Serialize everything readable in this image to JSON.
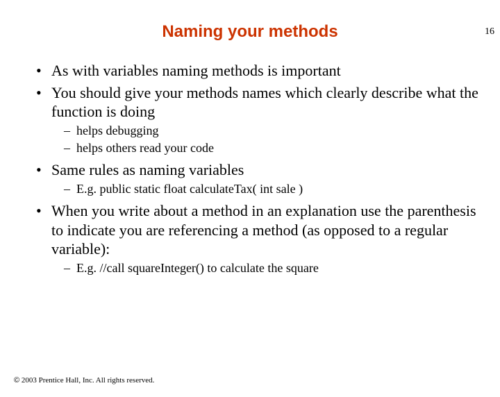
{
  "page_number": "16",
  "title": "Naming your methods",
  "bullets": {
    "b1": "As with variables naming methods is important",
    "b2": "You should give your methods names which clearly describe what the function is doing",
    "b2_1": "helps debugging",
    "b2_2": "helps others read your code",
    "b3": "Same rules as naming variables",
    "b3_1": "E.g. public static float calculateTax( int sale )",
    "b4": "When you write about a method in an explanation use the parenthesis to indicate you are referencing a method (as opposed to a regular variable):",
    "b4_1": "E.g. //call squareInteger() to calculate the square"
  },
  "footer": " 2003 Prentice Hall, Inc.  All rights reserved.",
  "copyright": "©"
}
